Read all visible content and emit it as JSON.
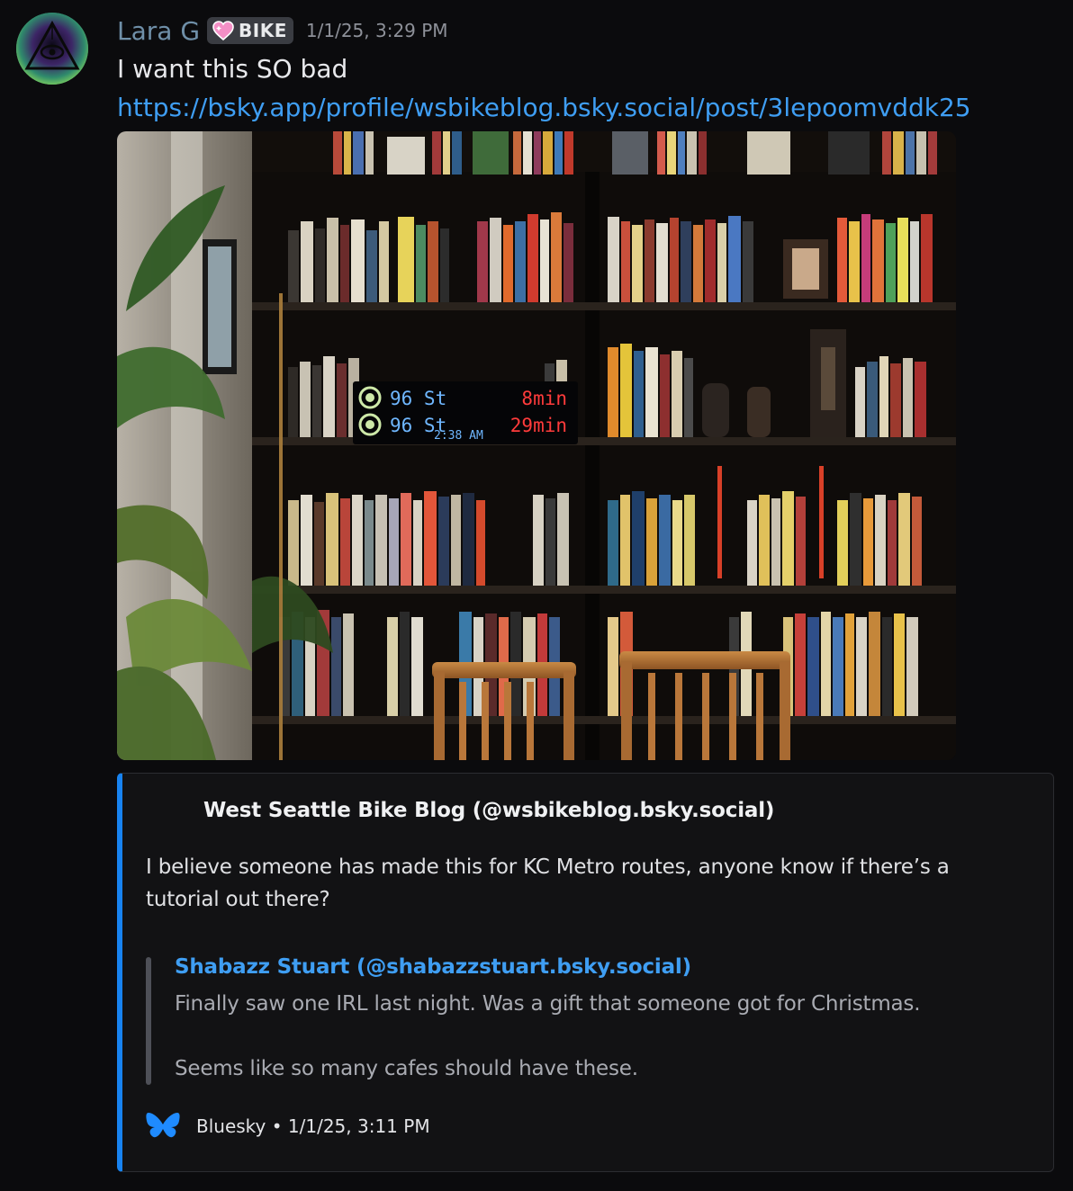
{
  "message": {
    "author": "Lara G",
    "role_tag": "BIKE",
    "timestamp": "1/1/25, 3:29 PM",
    "text": "I want this SO bad",
    "link": "https://bsky.app/profile/wsbikeblog.bsky.social/post/3lepoomvddk25"
  },
  "photo": {
    "sign_rows": [
      {
        "route": "96 St",
        "eta": "8min"
      },
      {
        "route": "96 St",
        "eta": "29min"
      }
    ],
    "sign_clock": "2:38 AM"
  },
  "embed": {
    "accent_color": "#1883f0",
    "author": "West Seattle Bike Blog (@wsbikeblog.bsky.social)",
    "description": "I believe someone has made this for KC Metro routes, anyone know if there’s a tutorial out there?",
    "quote": {
      "author": "Shabazz Stuart (@shabazzstuart.bsky.social)",
      "line1": "Finally saw one IRL last night. Was a gift that someone got for Christmas.",
      "line2": "Seems like so many cafes should have these."
    },
    "footer": "Bluesky • 1/1/25, 3:11 PM",
    "footer_icon": "butterfly-icon"
  }
}
